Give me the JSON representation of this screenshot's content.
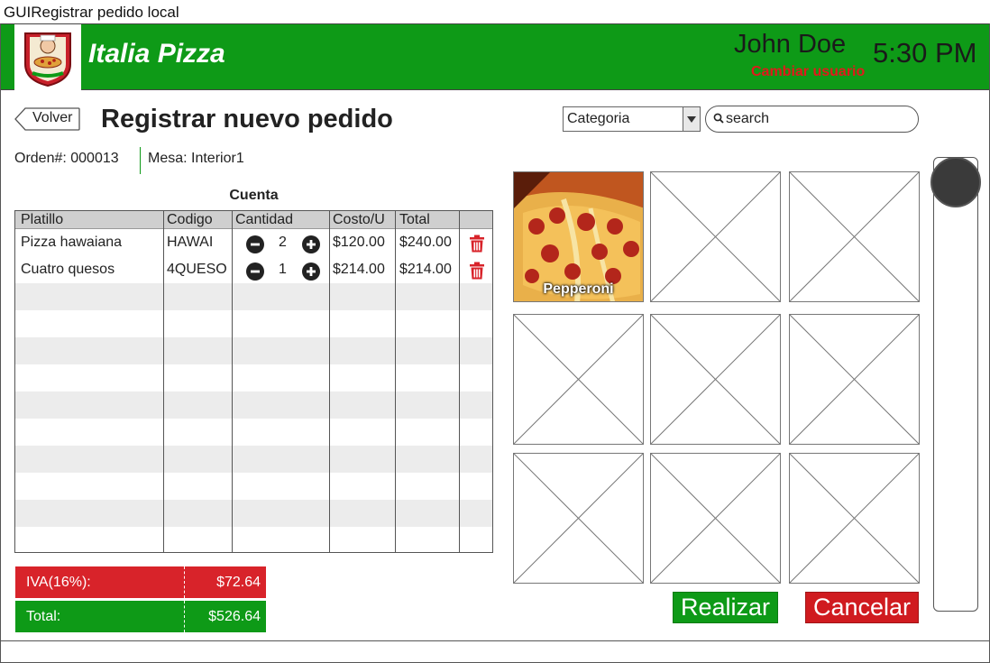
{
  "window": {
    "title": "GUIRegistrar pedido local"
  },
  "header": {
    "brand": "Italia Pizza",
    "user": "John Doe",
    "switch_user": "Cambiar usuario",
    "time": "5:30 PM",
    "colors": {
      "primary": "#0e9a17",
      "danger": "#e1191b"
    }
  },
  "toolbar": {
    "back_label": "Volver",
    "page_title": "Registrar nuevo pedido",
    "category_value": "Categoria",
    "search_placeholder": "search"
  },
  "order": {
    "number": "Orden#: 000013",
    "table": "Mesa: Interior1"
  },
  "account": {
    "title": "Cuenta",
    "columns": [
      "Platillo",
      "Codigo",
      "Cantidad",
      "Costo/U",
      "Total"
    ],
    "rows": [
      {
        "dish": "Pizza hawaiana",
        "code": "HAWAI",
        "qty": "2",
        "unit": "$120.00",
        "total": "$240.00"
      },
      {
        "dish": "Cuatro quesos",
        "code": "4QUESO",
        "qty": "1",
        "unit": "$214.00",
        "total": "$214.00"
      }
    ]
  },
  "summary": {
    "iva_label": "IVA(16%):",
    "iva_value": "$72.64",
    "total_label": "Total:",
    "total_value": "$526.64"
  },
  "products": {
    "tiles": [
      {
        "label": "Pepperoni",
        "has_image": true
      },
      {
        "label": "",
        "has_image": false
      },
      {
        "label": "",
        "has_image": false
      },
      {
        "label": "",
        "has_image": false
      },
      {
        "label": "",
        "has_image": false
      },
      {
        "label": "",
        "has_image": false
      },
      {
        "label": "",
        "has_image": false
      },
      {
        "label": "",
        "has_image": false
      },
      {
        "label": "",
        "has_image": false
      }
    ]
  },
  "actions": {
    "submit": "Realizar",
    "cancel": "Cancelar"
  }
}
